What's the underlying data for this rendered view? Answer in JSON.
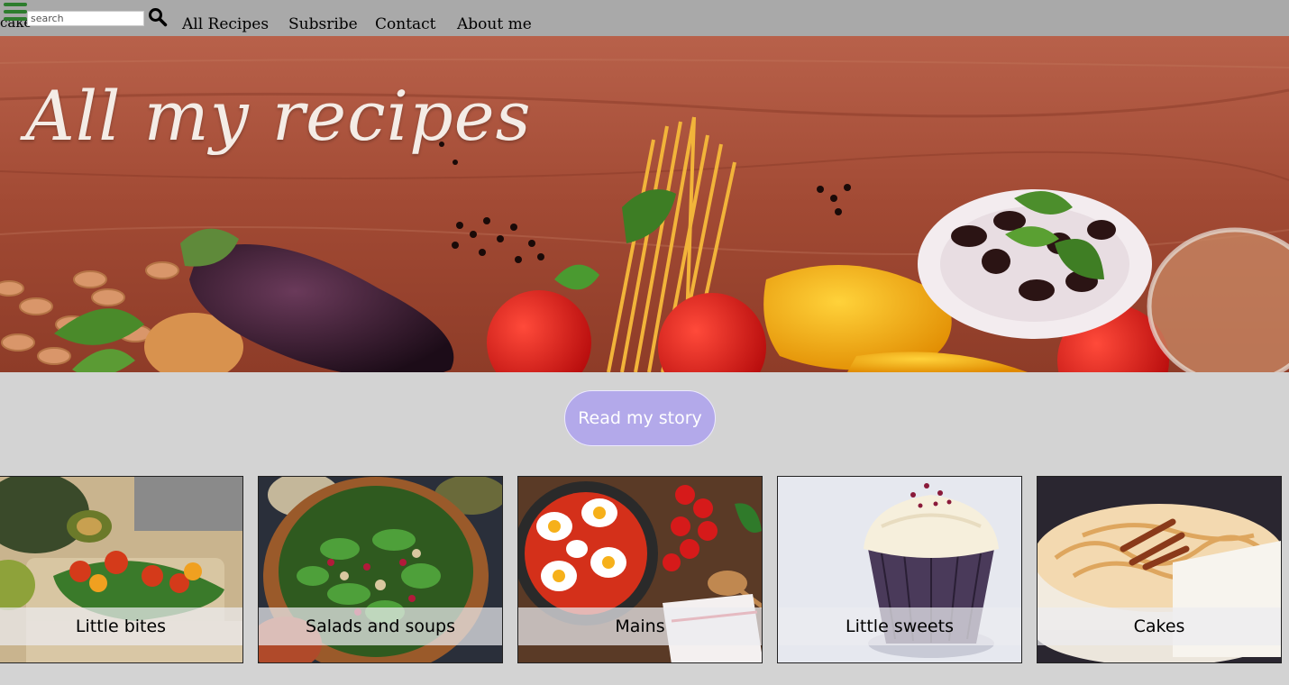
{
  "header": {
    "logo_text": "cake",
    "search": {
      "placeholder": "search",
      "value": ""
    },
    "nav": [
      {
        "label": "All Recipes"
      },
      {
        "label": "Subsribe"
      },
      {
        "label": "Contact"
      },
      {
        "label": "About me"
      }
    ],
    "icons": {
      "menu": "hamburger-menu-icon",
      "search": "magnifier-icon"
    },
    "colors": {
      "bar": "#a9a9a9",
      "menu_icon": "#2e7d2e"
    }
  },
  "hero": {
    "title": "All my recipes"
  },
  "cta": {
    "label": "Read my story",
    "color": "#b3a9ea"
  },
  "categories": [
    {
      "label": "Little bites"
    },
    {
      "label": "Salads and soups"
    },
    {
      "label": "Mains"
    },
    {
      "label": "Little sweets"
    },
    {
      "label": "Cakes"
    }
  ],
  "page": {
    "background": "#d3d3d3"
  }
}
